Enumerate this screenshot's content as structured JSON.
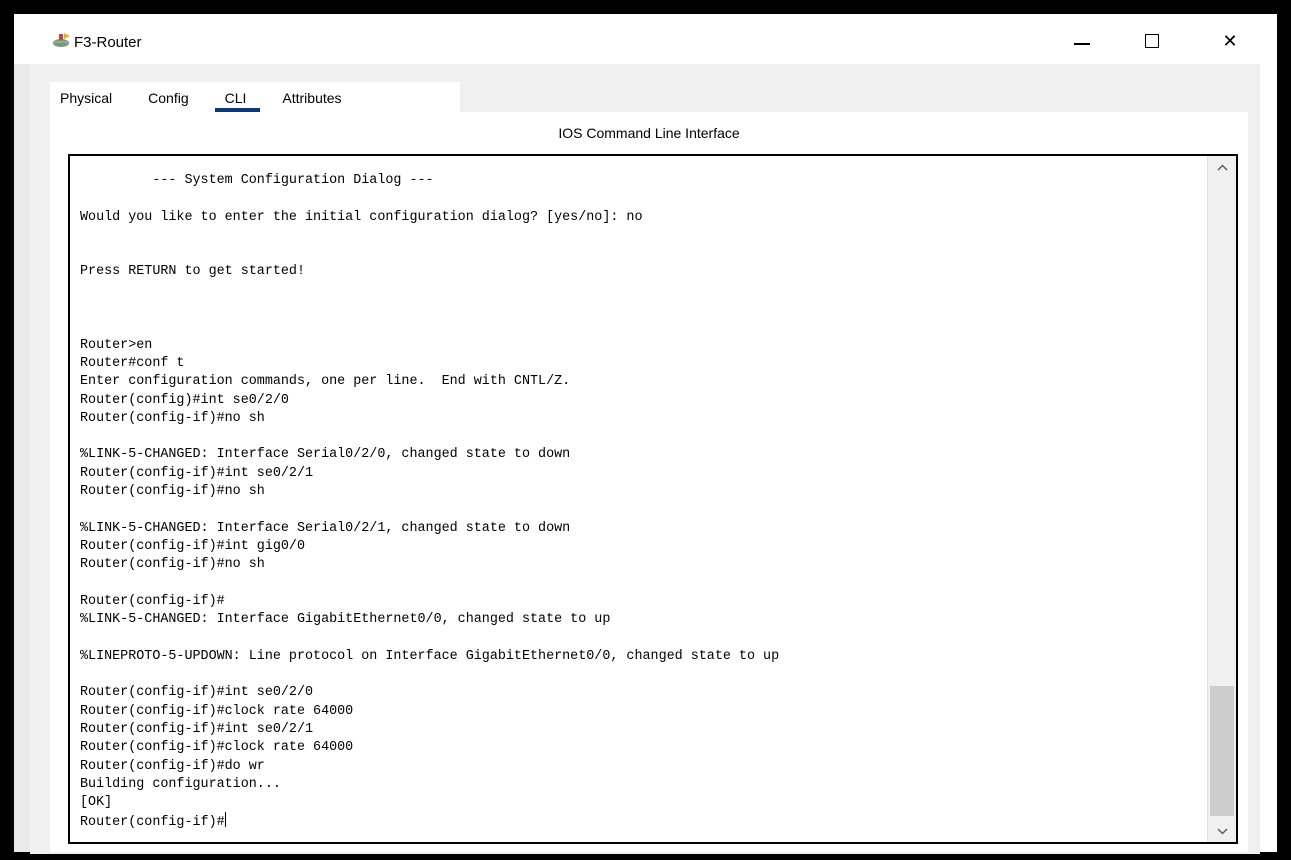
{
  "window": {
    "title": "F3-Router",
    "icon": "router-icon",
    "controls": {
      "minimize": "minimize-icon",
      "maximize": "maximize-icon",
      "close": "✕"
    }
  },
  "tabs": [
    {
      "label": "Physical",
      "active": false
    },
    {
      "label": "Config",
      "active": false
    },
    {
      "label": "CLI",
      "active": true
    },
    {
      "label": "Attributes",
      "active": false
    }
  ],
  "panel": {
    "title": "IOS Command Line Interface"
  },
  "console": {
    "lines": [
      "         --- System Configuration Dialog ---",
      "",
      "Would you like to enter the initial configuration dialog? [yes/no]: no",
      "",
      "",
      "Press RETURN to get started!",
      "",
      "",
      "",
      "Router>en",
      "Router#conf t",
      "Enter configuration commands, one per line.  End with CNTL/Z.",
      "Router(config)#int se0/2/0",
      "Router(config-if)#no sh",
      "",
      "%LINK-5-CHANGED: Interface Serial0/2/0, changed state to down",
      "Router(config-if)#int se0/2/1",
      "Router(config-if)#no sh",
      "",
      "%LINK-5-CHANGED: Interface Serial0/2/1, changed state to down",
      "Router(config-if)#int gig0/0",
      "Router(config-if)#no sh",
      "",
      "Router(config-if)#",
      "%LINK-5-CHANGED: Interface GigabitEthernet0/0, changed state to up",
      "",
      "%LINEPROTO-5-UPDOWN: Line protocol on Interface GigabitEthernet0/0, changed state to up",
      "",
      "Router(config-if)#int se0/2/0",
      "Router(config-if)#clock rate 64000",
      "Router(config-if)#int se0/2/1",
      "Router(config-if)#clock rate 64000",
      "Router(config-if)#do wr",
      "Building configuration...",
      "[OK]"
    ],
    "prompt": "Router(config-if)#"
  },
  "scrollbar": {
    "up_icon": "^",
    "down_icon": "v"
  }
}
